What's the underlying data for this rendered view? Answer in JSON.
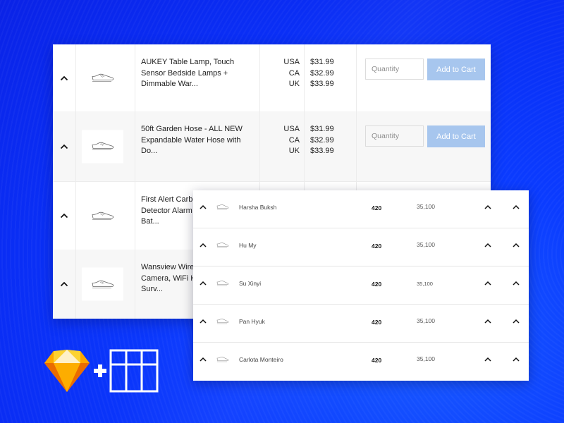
{
  "background": {
    "color": "#0b3cff"
  },
  "back_table": {
    "rows": [
      {
        "title_lines": [
          "AUKEY Table Lamp, Touch",
          "Sensor Bedside Lamps +",
          "Dimmable War..."
        ],
        "countries": [
          "USA",
          "CA",
          "UK"
        ],
        "prices": [
          "$31.99",
          "$32.99",
          "$33.99"
        ],
        "quantity_placeholder": "Quantity",
        "button_label": "Add to Cart",
        "show_actions": true
      },
      {
        "title_lines": [
          "50ft Garden Hose - ALL NEW",
          "Expandable Water Hose with",
          "Do..."
        ],
        "countries": [
          "USA",
          "CA",
          "UK"
        ],
        "prices": [
          "$31.99",
          "$32.99",
          "$33.99"
        ],
        "quantity_placeholder": "Quantity",
        "button_label": "Add to Cart",
        "show_actions": true
      },
      {
        "title_lines": [
          "First Alert Carbo",
          "Detector Alarm",
          "Bat..."
        ]
      },
      {
        "title_lines": [
          "Wansview Wirel",
          "Camera, WiFi H",
          "Surv..."
        ]
      }
    ],
    "icons": {
      "expand": "chevron-up-icon",
      "product": "sneaker-icon"
    },
    "button_color": "#a7c6ee"
  },
  "front_card": {
    "rows": [
      {
        "name": "Harsha Buksh",
        "count": "420",
        "value": "35,100"
      },
      {
        "name": "Hu My",
        "count": "420",
        "value": "35,100"
      },
      {
        "name": "Su Xinyi",
        "count": "420",
        "value": "35,100"
      },
      {
        "name": "Pan Hyuk",
        "count": "420",
        "value": "35,100"
      },
      {
        "name": "Carlota Monteiro",
        "count": "420",
        "value": "35,100"
      }
    ]
  },
  "logos": {
    "left": "sketch-diamond-logo",
    "plus": "plus-icon",
    "right": "table-grid-icon",
    "sketch_colors": [
      "#fdad00",
      "#fdd231",
      "#fea700",
      "#fdb300",
      "#ea6c00",
      "#fef0c8"
    ]
  }
}
